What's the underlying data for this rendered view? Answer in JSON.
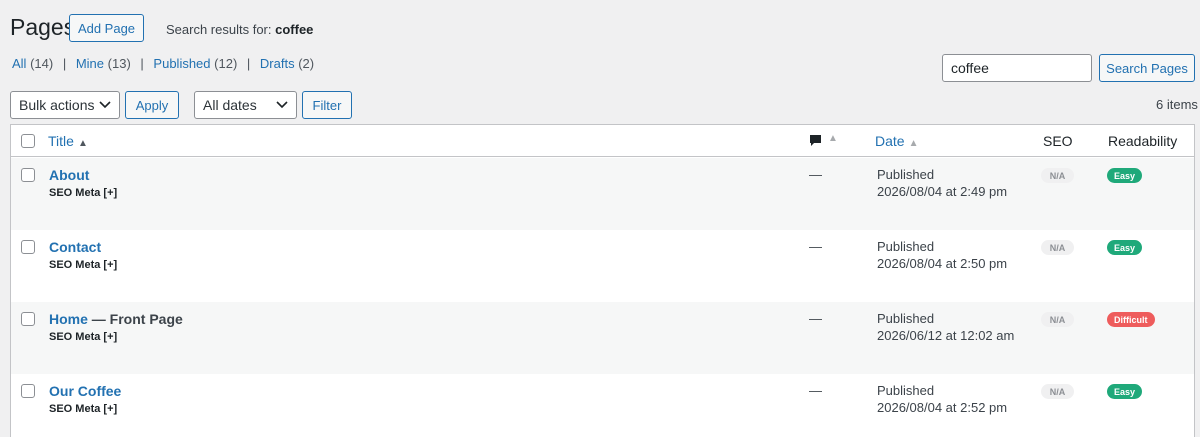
{
  "header": {
    "title": "Pages",
    "add_label": "Add Page",
    "search_label": "Search results for:",
    "search_term": "coffee"
  },
  "views": [
    {
      "label": "All",
      "count": "(14)"
    },
    {
      "label": "Mine",
      "count": "(13)"
    },
    {
      "label": "Published",
      "count": "(12)"
    },
    {
      "label": "Drafts",
      "count": "(2)"
    }
  ],
  "search": {
    "value": "coffee",
    "button": "Search Pages"
  },
  "toolbar": {
    "bulk": "Bulk actions",
    "apply": "Apply",
    "dates": "All dates",
    "filter": "Filter",
    "items": "6 items"
  },
  "columns": {
    "title": "Title",
    "date": "Date",
    "seo": "SEO",
    "readability": "Readability"
  },
  "rows": [
    {
      "title": "About",
      "suffix": "",
      "meta": "SEO Meta [+]",
      "comments": "—",
      "status": "Published",
      "date": "2026/08/04 at 2:49 pm",
      "seo": "N/A",
      "readability": "Easy",
      "readability_color": "#1fa97a"
    },
    {
      "title": "Contact",
      "suffix": "",
      "meta": "SEO Meta [+]",
      "comments": "—",
      "status": "Published",
      "date": "2026/08/04 at 2:50 pm",
      "seo": "N/A",
      "readability": "Easy",
      "readability_color": "#1fa97a"
    },
    {
      "title": "Home",
      "suffix": " — Front Page",
      "meta": "SEO Meta [+]",
      "comments": "—",
      "status": "Published",
      "date": "2026/06/12 at 12:02 am",
      "seo": "N/A",
      "readability": "Difficult",
      "readability_color": "#ee5c5c"
    },
    {
      "title": "Our Coffee",
      "suffix": "",
      "meta": "SEO Meta [+]",
      "comments": "—",
      "status": "Published",
      "date": "2026/08/04 at 2:52 pm",
      "seo": "N/A",
      "readability": "Easy",
      "readability_color": "#1fa97a"
    }
  ],
  "colors": {
    "accent": "#2271b1",
    "easy": "#1fa97a",
    "difficult": "#ee5c5c"
  }
}
